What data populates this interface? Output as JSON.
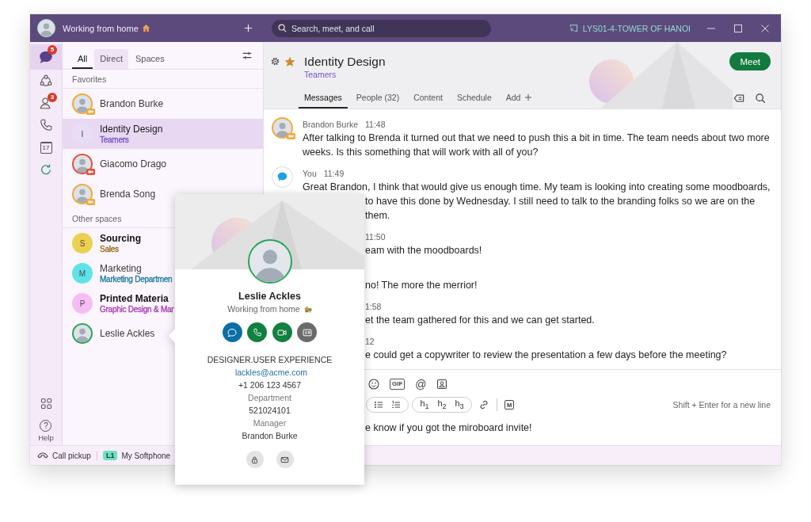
{
  "titlebar": {
    "status": "Working from home",
    "search": {
      "placeholder": "Search, meet, and call"
    },
    "location": "LYS01-4-TOWER OF HANOI"
  },
  "rail": {
    "items": [
      {
        "kind": "chat",
        "selected": true,
        "badge": "5"
      },
      {
        "kind": "teams",
        "selected": false
      },
      {
        "kind": "contacts",
        "selected": false,
        "badge": "3"
      },
      {
        "kind": "calls",
        "selected": false
      },
      {
        "kind": "calendar",
        "selected": false,
        "day": "17"
      },
      {
        "kind": "refresh",
        "selected": false
      }
    ],
    "bottom": [
      {
        "kind": "apps"
      },
      {
        "kind": "help",
        "symbol": "?",
        "label": "Help"
      }
    ]
  },
  "sidebar": {
    "tabs": [
      {
        "label": "All",
        "selected": true,
        "hovered": false
      },
      {
        "label": "Direct",
        "selected": false,
        "hovered": true
      },
      {
        "label": "Spaces",
        "selected": false,
        "hovered": false
      }
    ],
    "sections": [
      {
        "title": "Favorites",
        "items": [
          {
            "kind": "person",
            "name": "Brandon Burke",
            "color": "#f2a93b",
            "in_meeting": true,
            "unread": false,
            "selected": false
          },
          {
            "kind": "space",
            "initial": "I",
            "name": "Identity Design",
            "subtitle": {
              "text": "Teamers",
              "color": "#7b52c9"
            },
            "color": "#e9ddf6",
            "unread": false,
            "selected": true
          },
          {
            "kind": "person",
            "name": "Giacomo Drago",
            "color": "#e0533f",
            "in_meeting": true,
            "unread": false,
            "selected": false
          },
          {
            "kind": "person",
            "name": "Brenda Song",
            "color": "#f2a93b",
            "in_meeting": true,
            "unread": false,
            "selected": false
          }
        ]
      },
      {
        "title": "Other spaces",
        "items": [
          {
            "kind": "space",
            "initial": "S",
            "name": "Sourcing",
            "subtitle": {
              "text": "Sales",
              "color": "#9a6a1c"
            },
            "color": "#ecd04f",
            "unread": true,
            "selected": false
          },
          {
            "kind": "space",
            "initial": "M",
            "name": "Marketing",
            "subtitle": {
              "text": "Marketing Departmen",
              "color": "#1d7aa0"
            },
            "color": "#5ee3ea",
            "unread": false,
            "selected": false
          },
          {
            "kind": "space",
            "initial": "P",
            "name": "Printed Materia",
            "subtitle": {
              "text": "Graphic Design & Mar",
              "color": "#a63fb3"
            },
            "color": "#f6bdf4",
            "unread": true,
            "selected": false
          },
          {
            "kind": "person",
            "name": "Leslie Ackles",
            "color": "#2aa65c",
            "in_meeting": false,
            "unread": false,
            "selected": false
          }
        ]
      }
    ]
  },
  "chat": {
    "title": "Identity Design",
    "subtitle": "Teamers",
    "starred": true,
    "meet": "Meet",
    "tabs": [
      {
        "kind": "tab",
        "label": "Messages",
        "selected": true
      },
      {
        "kind": "tab",
        "label": "People (32)",
        "selected": false
      },
      {
        "kind": "tab",
        "label": "Content",
        "selected": false
      },
      {
        "kind": "tab",
        "label": "Schedule",
        "selected": false
      },
      {
        "kind": "add",
        "label": "Add",
        "selected": false
      }
    ],
    "messages": [
      {
        "sender": "Brandon Burke",
        "time": "11:48",
        "avatar": {
          "kind": "person",
          "color": "#f2a93b",
          "in_meeting": true
        },
        "covered": false,
        "lines": [
          {
            "text": "After talking to Brenda it turned out that we need to push this a bit in time. The team needs about two more weeks. Is this something that will work with all of you?",
            "covered": false
          }
        ]
      },
      {
        "sender": "You",
        "time": "11:49",
        "avatar": {
          "kind": "self"
        },
        "covered": false,
        "lines": [
          {
            "text": "Great Brandon, I think that would give us enough time. My team is looking into creating some moodboards,",
            "covered": false
          },
          {
            "text": "to have this done by Wednesday. I still need to talk to the branding folks so we are on the",
            "covered": true
          },
          {
            "text": "them.",
            "covered": true
          }
        ]
      },
      {
        "time": "11:50",
        "covered": true,
        "lines": [
          {
            "text": "eam with the moodboards!",
            "covered": true
          }
        ]
      },
      {
        "lines": [
          {
            "text": "no! The more the merrior!",
            "covered": true
          }
        ]
      },
      {
        "time": "1:58",
        "covered": true,
        "lines": [
          {
            "text": "et the team gathered for this and we can get started.",
            "covered": true
          }
        ]
      },
      {
        "time": "12",
        "covered": true,
        "lines": [
          {
            "text": "e could get a copywriter to review the presentation a few days before the meeting?",
            "covered": true
          }
        ]
      }
    ]
  },
  "composer": {
    "tools": [
      {
        "kind": "emoji"
      },
      {
        "kind": "gif",
        "label": "GIF"
      },
      {
        "kind": "mention",
        "label": "@"
      },
      {
        "kind": "contact"
      }
    ],
    "format": [
      {
        "kind": "group",
        "items": [
          {
            "kind": "bullets"
          },
          {
            "kind": "numbers"
          }
        ]
      },
      {
        "kind": "group",
        "items": [
          {
            "kind": "heading",
            "label": "h$_{1}$"
          },
          {
            "kind": "heading",
            "label": "h$_{2}$"
          },
          {
            "kind": "heading",
            "label": "h$_{3}$"
          }
        ]
      },
      {
        "kind": "link"
      },
      {
        "kind": "divider"
      },
      {
        "kind": "markdown",
        "label": "M"
      }
    ],
    "hint": "Shift + Enter for a new line",
    "value": "e know if you got the miroboard invite!"
  },
  "status_bar": {
    "items": [
      {
        "kind": "call_pickup",
        "label": "Call pickup"
      },
      {
        "kind": "line",
        "badge": "L1",
        "label": "My Softphone"
      }
    ]
  },
  "profile_card": {
    "name": "Leslie Ackles",
    "status": "Working from home",
    "color": "#2aa65c",
    "actions": [
      {
        "kind": "message",
        "color": "#0b6fa3"
      },
      {
        "kind": "call",
        "color": "#12803f"
      },
      {
        "kind": "video",
        "color": "#12803f"
      },
      {
        "kind": "card",
        "color": "#6b6b6b"
      }
    ],
    "details": [
      {
        "kind": "text",
        "text": "DESIGNER.USER EXPERIENCE"
      },
      {
        "kind": "link",
        "text": "lackles@acme.com"
      },
      {
        "kind": "text",
        "text": "+1 206 123 4567"
      },
      {
        "kind": "label",
        "text": "Department"
      },
      {
        "kind": "text",
        "text": "521024101"
      },
      {
        "kind": "label",
        "text": "Manager"
      },
      {
        "kind": "text",
        "text": "Brandon Burke"
      }
    ],
    "footer": [
      {
        "kind": "lock"
      },
      {
        "kind": "mail"
      }
    ]
  }
}
